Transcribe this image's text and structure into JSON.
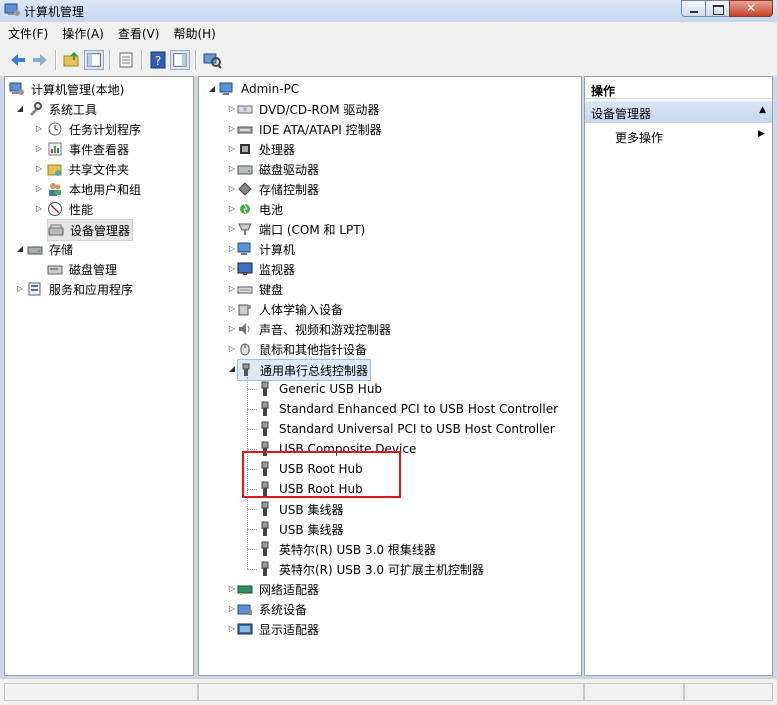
{
  "window": {
    "title": "计算机管理"
  },
  "menu": [
    {
      "label": "文件(F)"
    },
    {
      "label": "操作(A)"
    },
    {
      "label": "查看(V)"
    },
    {
      "label": "帮助(H)"
    }
  ],
  "left_tree": [
    {
      "label": "计算机管理(本地)",
      "icon": "computer-management-icon"
    },
    {
      "label": "系统工具",
      "icon": "tools-icon"
    },
    {
      "label": "任务计划程序",
      "icon": "task-scheduler-icon"
    },
    {
      "label": "事件查看器",
      "icon": "event-viewer-icon"
    },
    {
      "label": "共享文件夹",
      "icon": "shared-folders-icon"
    },
    {
      "label": "本地用户和组",
      "icon": "users-icon"
    },
    {
      "label": "性能",
      "icon": "performance-icon"
    },
    {
      "label": "设备管理器",
      "icon": "device-manager-icon"
    },
    {
      "label": "存储",
      "icon": "storage-icon"
    },
    {
      "label": "磁盘管理",
      "icon": "disk-management-icon"
    },
    {
      "label": "服务和应用程序",
      "icon": "services-icon"
    }
  ],
  "device_tree": {
    "root": "Admin-PC",
    "categories": [
      {
        "label": "DVD/CD-ROM 驱动器",
        "icon": "dvd-drive-icon"
      },
      {
        "label": "IDE ATA/ATAPI 控制器",
        "icon": "ide-controller-icon"
      },
      {
        "label": "处理器",
        "icon": "processor-icon"
      },
      {
        "label": "磁盘驱动器",
        "icon": "disk-drive-icon"
      },
      {
        "label": "存储控制器",
        "icon": "storage-controller-icon"
      },
      {
        "label": "电池",
        "icon": "battery-icon"
      },
      {
        "label": "端口 (COM 和 LPT)",
        "icon": "port-icon"
      },
      {
        "label": "计算机",
        "icon": "computer-icon"
      },
      {
        "label": "监视器",
        "icon": "monitor-icon"
      },
      {
        "label": "键盘",
        "icon": "keyboard-icon"
      },
      {
        "label": "人体学输入设备",
        "icon": "hid-icon"
      },
      {
        "label": "声音、视频和游戏控制器",
        "icon": "sound-icon"
      },
      {
        "label": "鼠标和其他指针设备",
        "icon": "mouse-icon"
      },
      {
        "label": "通用串行总线控制器",
        "icon": "usb-icon"
      }
    ],
    "usb_children": [
      "Generic USB Hub",
      "Standard Enhanced PCI to USB Host Controller",
      "Standard Universal PCI to USB Host Controller",
      "USB Composite Device",
      "USB Root Hub",
      "USB Root Hub",
      "USB 集线器",
      "USB 集线器",
      "英特尔(R) USB 3.0 根集线器",
      "英特尔(R) USB 3.0 可扩展主机控制器"
    ],
    "after": [
      {
        "label": "网络适配器",
        "icon": "network-adapter-icon"
      },
      {
        "label": "系统设备",
        "icon": "system-devices-icon"
      },
      {
        "label": "显示适配器",
        "icon": "display-adapter-icon"
      }
    ]
  },
  "actions": {
    "header": "操作",
    "section": "设备管理器",
    "more": "更多操作"
  }
}
